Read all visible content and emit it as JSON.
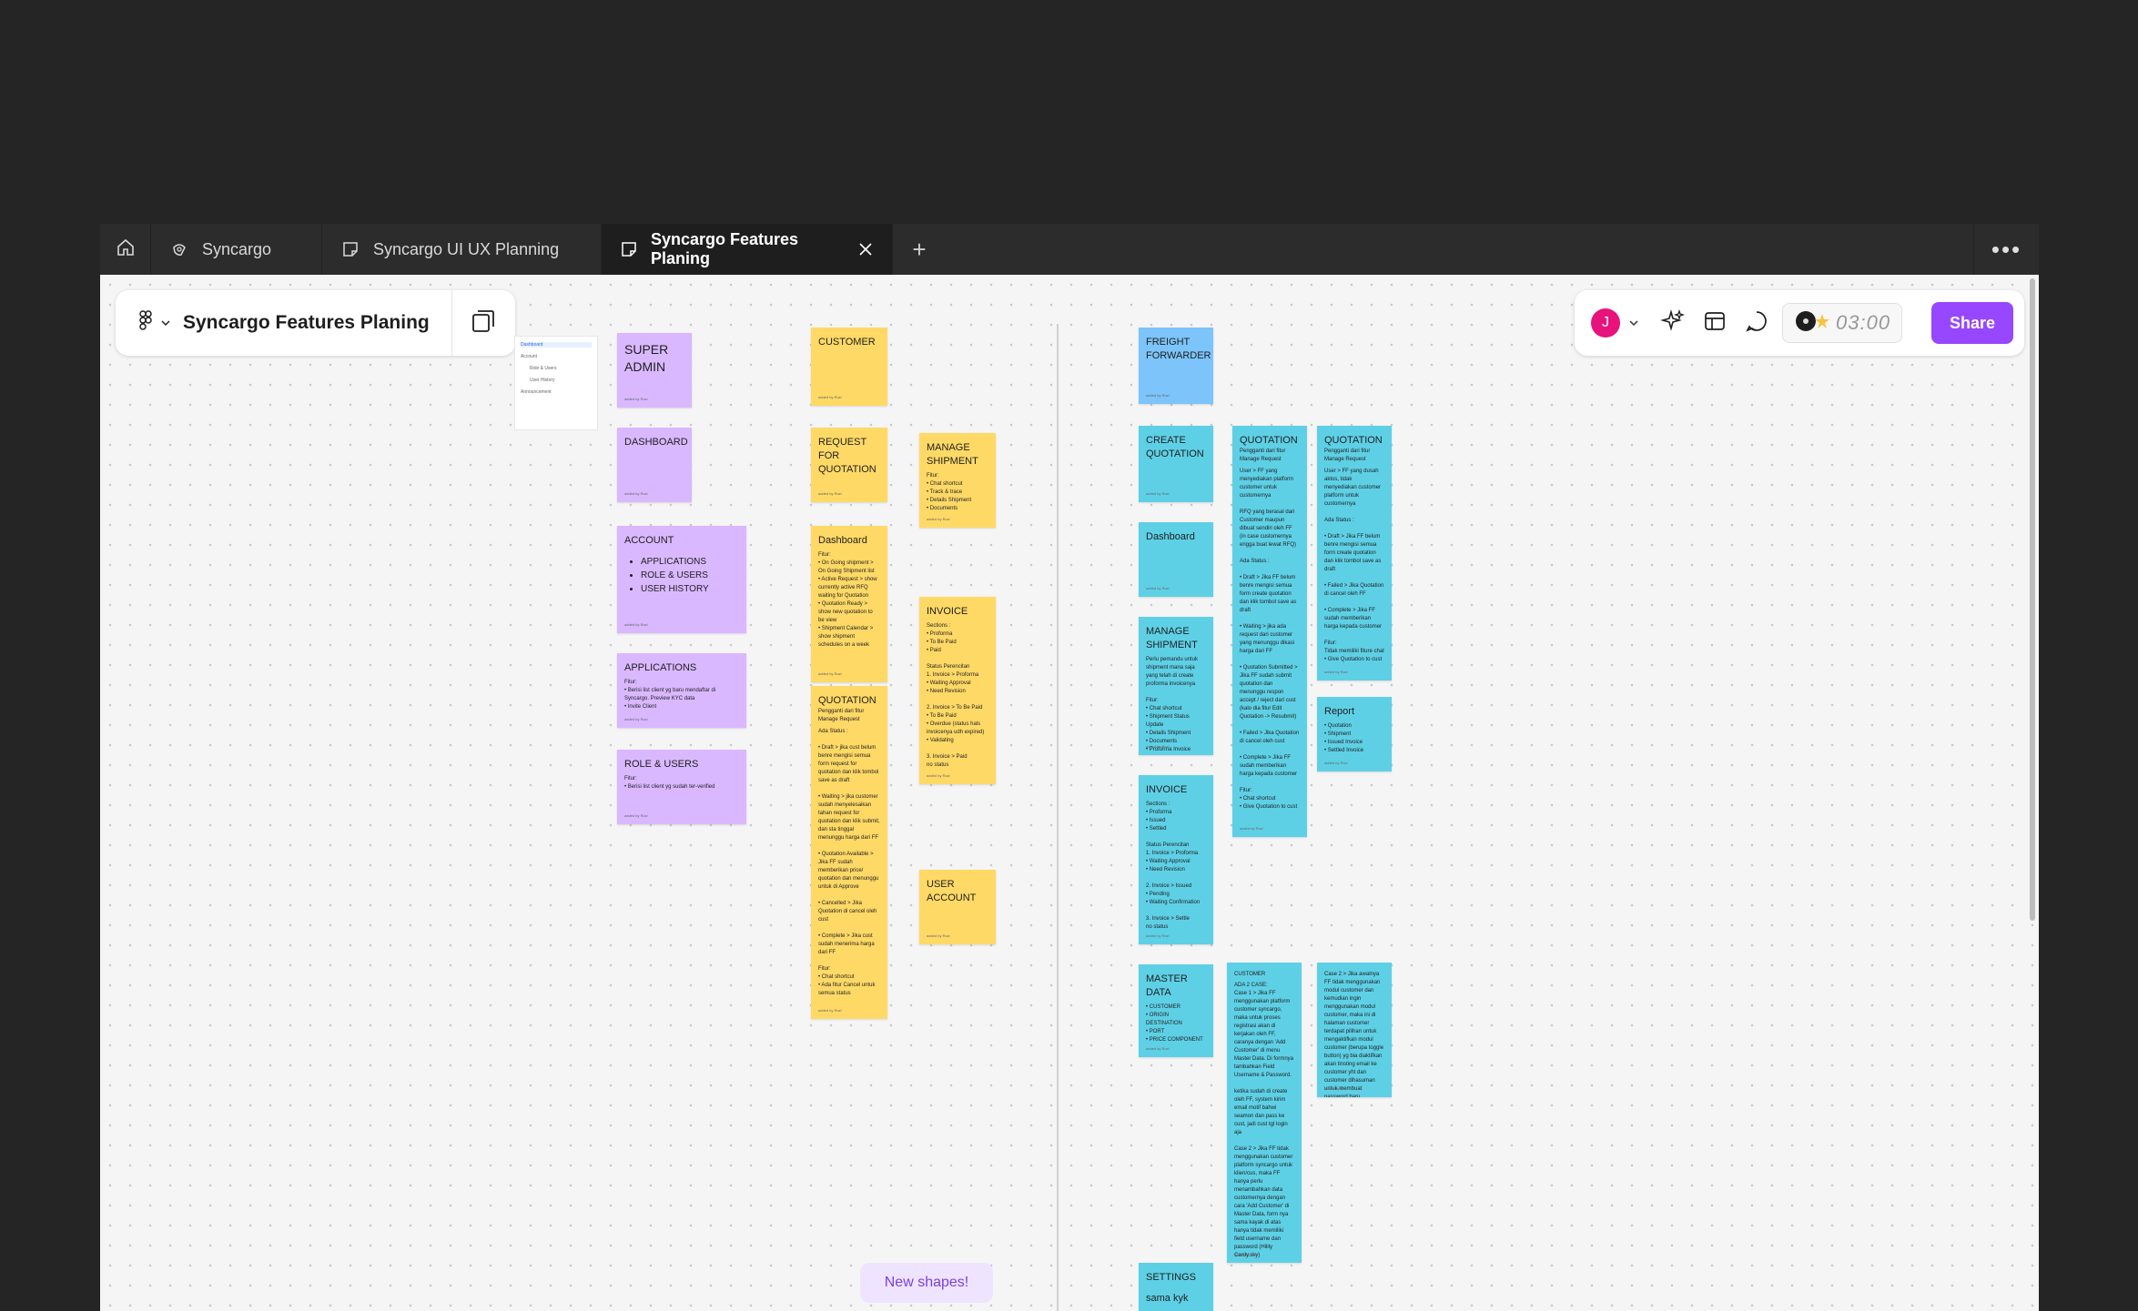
{
  "tabs": {
    "home_icon": "home-icon",
    "items": [
      {
        "label": "Syncargo",
        "icon": "figma-logo-icon"
      },
      {
        "label": "Syncargo UI UX Planning",
        "icon": "figjam-file-icon"
      },
      {
        "label": "Syncargo Features Planing",
        "icon": "figjam-file-icon",
        "active": true
      }
    ],
    "add_label": "+",
    "more_label": "•••"
  },
  "file": {
    "title": "Syncargo Features Planing",
    "menu_icon": "figma-menu-icon",
    "pages_icon": "pages-icon"
  },
  "toolbar": {
    "avatar_initial": "J",
    "avatar_color": "#e8127c",
    "timer": "03:00",
    "share_label": "Share",
    "share_color": "#9747ff"
  },
  "thumbnail": {
    "items": [
      "Dashboard",
      "Account",
      "Role & Users",
      "User History",
      "Announcement"
    ]
  },
  "stickies": {
    "super_admin": {
      "title": "SUPER ADMIN",
      "meta": "added by Rozi"
    },
    "dashboard_p": {
      "title": "DASHBOARD",
      "meta": "added by Rozi"
    },
    "account": {
      "title": "ACCOUNT",
      "items": [
        "APPLICATIONS",
        "ROLE & USERS",
        "USER HISTORY"
      ],
      "meta": "added by Rozi"
    },
    "applications": {
      "title": "APPLICATIONS",
      "body": "Fitur:\n• Berisi list client yg baru mendaftar di Syncargo. Preview KYC data\n• Invite Client",
      "meta": "added by Rozi"
    },
    "role_users": {
      "title": "ROLE & USERS",
      "body": "Fitur:\n• Berisi list client yg sudah ter-verified",
      "meta": "added by Rozi"
    },
    "customer": {
      "title": "CUSTOMER",
      "meta": "added by Rozi"
    },
    "request_quotation": {
      "title": "REQUEST FOR QUOTATION",
      "meta": "added by Rozi"
    },
    "dashboard_y": {
      "title": "Dashboard",
      "body": "Fitur:\n• On Going shipment > On Going Shipment list\n• Active Request > show currently active RFQ waiting for Quotation\n• Quotation Ready > show new quotation to be view\n• Shipment Calendar > show shipment schedules on a week",
      "meta": "added by Rozi"
    },
    "quotation_y": {
      "title": "QUOTATION",
      "sub": "Pengganti dari fitur Manage Request",
      "body": "Ada Status :\n\n• Draft > jika cust belum benre mengisi semua form request for quotation dan klik tombol save as draft\n\n• Waiting > jika customer sudah menyelesaikan tahan request for quotation dan klik submit, dan sta tinggal menunggu harga dari FF\n\n• Quotation Available > Jika FF sudah memberikan price/ quotation dan menunggu untuk di Approve\n\n• Cancelled > Jika Quotation di cancel oleh cust\n\n• Complete > Jika cust sudah menerima harga dari FF\n\nFitur:\n• Chat shortcut\n• Ada fitur Cancel untuk semua status",
      "meta": "added by Rozi"
    },
    "manage_shipment": {
      "title": "MANAGE SHIPMENT",
      "body": "Fitur:\n• Chat shortcut\n• Track & trace\n• Details Shipment\n• Documents",
      "meta": "added by Rozi"
    },
    "invoice_y": {
      "title": "INVOICE",
      "body": "Sections :\n• Proforma\n• To Be Paid\n• Paid\n\nStatus Perencitan\n1. Invoice > Proforma\n• Waiting Approval\n• Need Revision\n\n2. Invoice > To Be Paid\n• To Be Paid\n• Overdue (status hals invoicenya udh expired)\n• Validating\n\n3. Invoice > Paid\nno status",
      "meta": "added by Rozi"
    },
    "user_account": {
      "title": "USER ACCOUNT",
      "meta": "added by Rozi"
    },
    "freight_forwarder": {
      "title": "FREIGHT FORWARDER",
      "meta": "added by Rozi"
    },
    "create_quotation": {
      "title": "CREATE QUOTATION",
      "meta": "added by Rozi"
    },
    "dashboard_b": {
      "title": "Dashboard",
      "meta": "added by Rozi"
    },
    "manage_shipment_b": {
      "title": "MANAGE SHIPMENT",
      "body": "Perlu pemandu untuk shipment mana saja yang telah di create proforma invoicenya\n\nFitur:\n• Chat shortcut\n• Shipment Status Update\n• Details Shipment\n• Documents\n• Proforma Invoice",
      "meta": "added by Rozi"
    },
    "invoice_b": {
      "title": "INVOICE",
      "body": "Sections :\n• Proforma\n• Issued\n• Settled\n\nStatus Perencitan\n1. Invoice > Proforma\n• Waiting Approval\n• Need Revision\n\n2. Invoice > Issued\n• Pending\n• Waiting Confirmation\n\n3. Invoice > Settle\nno status",
      "meta": "added by Rozi"
    },
    "master_data": {
      "title": "MASTER DATA",
      "body": "• CUSTOMER\n• ORIGIN DESTINATION\n• PORT\n• PRICE COMPONENT",
      "meta": "added by Rozi"
    },
    "settings": {
      "title": "SETTINGS",
      "body": "sama kyk"
    },
    "quotation_b1": {
      "title": "QUOTATION",
      "sub": "Pengganti dari fitur Manage Request",
      "body": "User > FF yang menyediakan platform customer untuk customernya\n\nRFQ yang berasal dari Customer maupun dibuat sendiri oleh FF (in case customernya engga buat lewat RFQ)\n\nAda Status :\n\n• Draft > Jika FF belum benre mengisi semua form create quotation dan klik tombol save as draft\n\n• Waiting > jika ada request dari customer yang menunggu dikasi harga dari FF\n\n• Quotation Submitted > Jika FF sudah submit quotation dan menunggu respon accept / reject dari cust (kalo dia fitur Edit Quotation -> Resubmit)\n\n• Failed > Jika Quotation di cancel oleh cust\n\n• Complete > Jika FF sudah memberikan harga kepada customer\n\nFitur:\n• Chat shortcut\n• Give Quotation to cust",
      "meta": "added by Rozi"
    },
    "quotation_b2": {
      "title": "QUOTATION",
      "sub": "Pengganti dari fitur Manage Request",
      "body": "User > FF yang dusah aktos, tidak menyediakan customer platform untuk customernya\n\nAda Status :\n\n• Draft > Jika FF belum benre mengisi semua form create quotation dan klik tombol save as draft\n\n• Failed > Jika Quotation di cancel oleh FF\n\n• Complete > Jika FF sudah memberikan harga kepada customer\n\nFitur:\nTidak memiliki fiture chat\n• Give Quotation to cust",
      "meta": "added by Rozi"
    },
    "report": {
      "title": "Report",
      "body": "• Quotation\n• Shipment\n• Issued Invoice\n• Settled Invoice",
      "meta": "added by Rozi"
    },
    "customer_case": {
      "title": "CUSTOMER",
      "body": "ADA 2 CASE:\nCase 1 > Jika FF menggunakan platform customer syncargo, maka untuk proses registrasi akan di kerjakan oleh FF, caranya dengan 'Add Customer' di menu Master Data. Di formnya tambahkan Field Username & Password.\n\nketika sudah di create oleh FF, system kirim email motif bahwi seamon dan pass ke cust, jadi cust tgl login aja\n\nCase 2 > Jika FF tidak menggunakan customer platform syncargo untuk klien/cus, maka FF hanya perlu menambahkan data customernya dengan cara 'Add Customer' di Master Data, form nya sama kayak di atas hanya tidak memiliki field username dan password (Hilily Cardy.sky)",
      "meta": "added by Rozi"
    },
    "case2": {
      "title": "",
      "body": "Case 2 > Jika awalnya FF tidak menggunakan modul customer dan kemudian ingin menggunakan modul customer, maka ini di halaman customer terdapat pilihan untuk mengaktifkan modul customer (berupa toggle button) yg bia diaktifkan akan tinsting email ke customer yht dan customer dihasuman untuk membuat password baru",
      "meta": "added by Rozi"
    }
  },
  "new_shapes_label": "New shapes!"
}
